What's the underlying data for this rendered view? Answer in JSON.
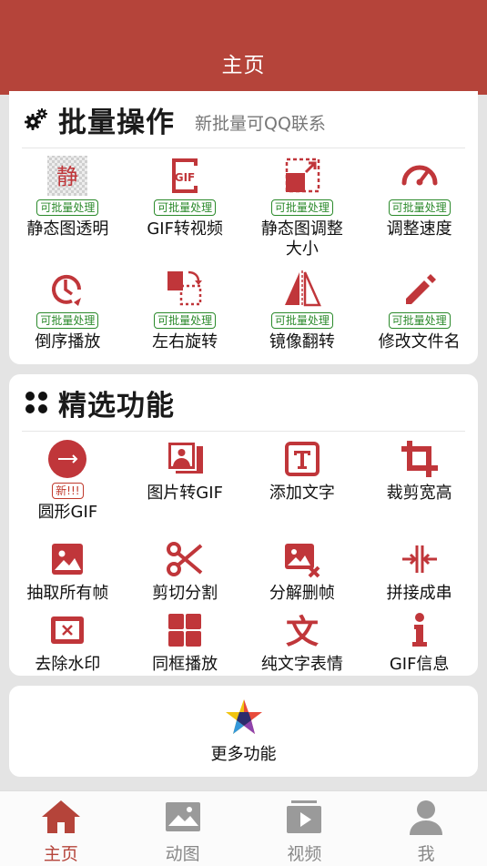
{
  "header": {
    "title": "主页"
  },
  "batch": {
    "title": "批量操作",
    "subtitle": "新批量可QQ联系",
    "badge": "可批量处理",
    "items": [
      {
        "label": "静态图透明",
        "icon": "static-transparent-icon",
        "badge": "可批量处理",
        "glyph": "静"
      },
      {
        "label": "GIF转视频",
        "icon": "gif-icon",
        "badge": "可批量处理"
      },
      {
        "label": "静态图调整\n大小",
        "icon": "resize-icon",
        "badge": "可批量处理"
      },
      {
        "label": "调整速度",
        "icon": "speedometer-icon",
        "badge": "可批量处理"
      },
      {
        "label": "倒序播放",
        "icon": "reverse-clock-icon",
        "badge": "可批量处理"
      },
      {
        "label": "左右旋转",
        "icon": "rotate-icon",
        "badge": "可批量处理"
      },
      {
        "label": "镜像翻转",
        "icon": "mirror-flip-icon",
        "badge": "可批量处理"
      },
      {
        "label": "修改文件名",
        "icon": "pencil-icon",
        "badge": "可批量处理"
      }
    ]
  },
  "featured": {
    "title": "精选功能",
    "items": [
      {
        "label": "圆形GIF",
        "icon": "circle-gif-icon",
        "badge": "新!!!"
      },
      {
        "label": "图片转GIF",
        "icon": "images-icon"
      },
      {
        "label": "添加文字",
        "icon": "text-icon"
      },
      {
        "label": "裁剪宽高",
        "icon": "crop-icon"
      },
      {
        "label": "抽取所有帧",
        "icon": "image-icon"
      },
      {
        "label": "剪切分割",
        "icon": "scissors-icon"
      },
      {
        "label": "分解删帧",
        "icon": "image-delete-icon"
      },
      {
        "label": "拼接成串",
        "icon": "join-icon"
      },
      {
        "label": "去除水印",
        "icon": "watermark-remove-icon"
      },
      {
        "label": "同框播放",
        "icon": "grid-icon"
      },
      {
        "label": "纯文字表情",
        "icon": "wen-text-icon",
        "glyph": "文"
      },
      {
        "label": "GIF信息",
        "icon": "info-icon"
      }
    ]
  },
  "more": {
    "label": "更多功能",
    "icon": "star-icon"
  },
  "tabs": [
    {
      "label": "主页",
      "icon": "home-icon",
      "active": true
    },
    {
      "label": "动图",
      "icon": "gallery-icon",
      "active": false
    },
    {
      "label": "视频",
      "icon": "video-icon",
      "active": false
    },
    {
      "label": "我",
      "icon": "user-icon",
      "active": false
    }
  ],
  "colors": {
    "accent": "#b5443a",
    "icon_red": "#c0363a",
    "badge_green": "#2b8a2b",
    "tab_gray": "#888888"
  }
}
